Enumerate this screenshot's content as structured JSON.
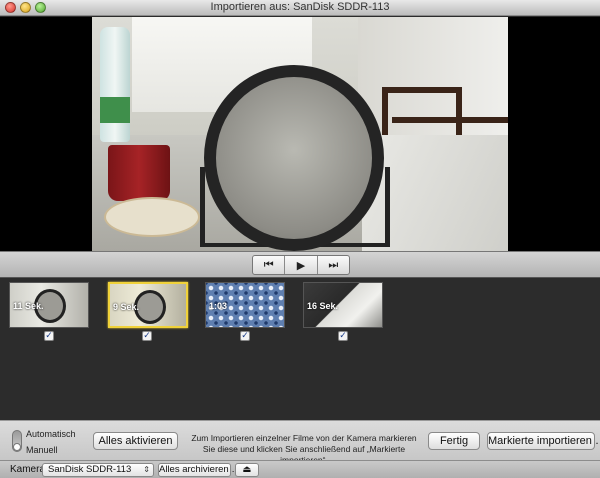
{
  "window": {
    "title": "Importieren aus: SanDisk SDDR-113"
  },
  "playback": {
    "prev_icon": "⏮",
    "play_icon": "▶",
    "next_icon": "⏭",
    "prev_icon_name": "skip-back-icon",
    "play_icon_name": "play-icon",
    "next_icon_name": "skip-forward-icon"
  },
  "clips": [
    {
      "duration": "11 Sek.",
      "checked": true,
      "selected": false
    },
    {
      "duration": "9 Sek.",
      "checked": true,
      "selected": true
    },
    {
      "duration": "1:03",
      "checked": true,
      "selected": false
    },
    {
      "duration": "16 Sek.",
      "checked": true,
      "selected": false
    }
  ],
  "checkbox_glyph": "✓",
  "mode": {
    "automatic_label": "Automatisch",
    "manual_label": "Manuell",
    "selected": "Manuell"
  },
  "buttons": {
    "activate_all": "Alles aktivieren",
    "done": "Fertig",
    "import_marked": "Markierte importieren …"
  },
  "instructions": "Zum Importieren einzelner Filme von der Kamera markieren Sie diese und klicken Sie anschließend auf „Markierte importieren“.",
  "status_bar": {
    "camera_label": "Kamera:",
    "camera_value": "SanDisk SDDR-113",
    "dropdown_arrow": "⇕",
    "archive_all": "Alles archivieren …",
    "eject_icon": "⏏"
  },
  "colors": {
    "selected_border": "#f0d23a",
    "thumb_background": "#2c2c2c"
  }
}
